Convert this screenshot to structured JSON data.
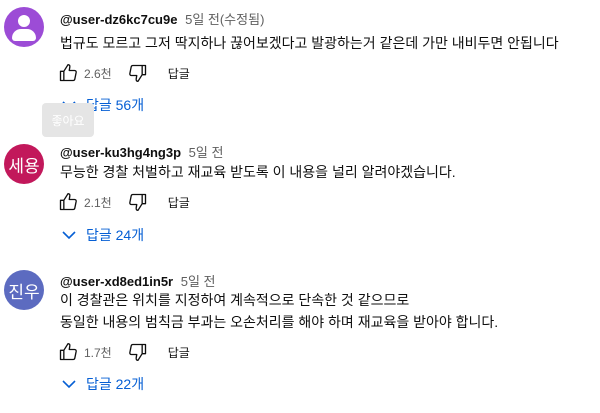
{
  "comments": [
    {
      "author": "@user-dz6kc7cu9e",
      "time": "5일 전(수정됨)",
      "avatar_text": "",
      "avatar_color": "#9c4cd6",
      "lines": [
        "법규도 모르고 그저 딱지하나 끊어보겠다고 발광하는거 같은데 가만 내비두면 안됩니다"
      ],
      "likes": "2.6천",
      "reply_label": "답글",
      "replies_label": "답글 56개"
    },
    {
      "author": "@user-ku3hg4ng3p",
      "time": "5일 전",
      "avatar_text": "세용",
      "avatar_color": "#c2185b",
      "lines": [
        "무능한 경찰 처벌하고 재교육 받도록 이 내용을 널리 알려야겠습니다."
      ],
      "likes": "2.1천",
      "reply_label": "답글",
      "replies_label": "답글 24개"
    },
    {
      "author": "@user-xd8ed1in5r",
      "time": "5일 전",
      "avatar_text": "진우",
      "avatar_color": "#5c6bc0",
      "lines": [
        "이 경찰관은 위치를 지정하여 계속적으로 단속한 것 같으므로",
        "동일한 내용의 범칙금 부과는 오손처리를 해야 하며 재교육을 받아야 합니다."
      ],
      "likes": "1.7천",
      "reply_label": "답글",
      "replies_label": "답글 22개"
    }
  ],
  "tooltip": {
    "text": "좋아요"
  }
}
